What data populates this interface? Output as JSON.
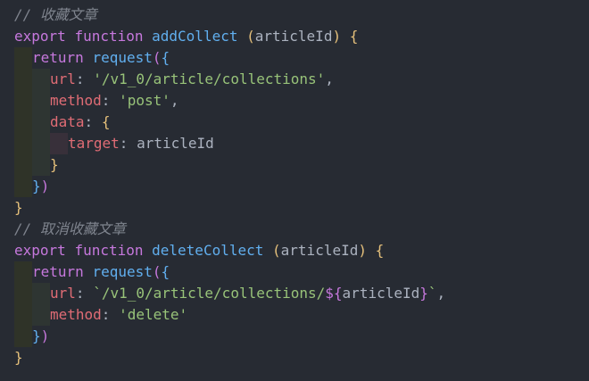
{
  "code": {
    "comment1": "// 收藏文章",
    "comment2": "// 取消收藏文章",
    "kw_export": "export",
    "kw_function": "function",
    "kw_return": "return",
    "fn_add": "addCollect",
    "fn_delete": "deleteCollect",
    "fn_request": "request",
    "param": "articleId",
    "prop_url": "url",
    "prop_method": "method",
    "prop_data": "data",
    "prop_target": "target",
    "colon": ":",
    "comma": ",",
    "open_paren": "(",
    "close_paren": ")",
    "open_brace": "{",
    "close_brace": "}",
    "str_add_url": "'/v1_0/article/collections'",
    "str_post": "'post'",
    "tmpl_delete_url_start": "`/v1_0/article/collections/",
    "tmpl_dollar": "${",
    "tmpl_close_brace": "}",
    "tmpl_backtick": "`",
    "str_delete": "'delete'",
    "target_value": "articleId"
  },
  "theme": {
    "background": "#272b33",
    "comment": "#7f848e",
    "keyword": "#c678dd",
    "function": "#61afef",
    "property": "#e06c75",
    "string": "#98c379",
    "plain": "#abb2bf",
    "bracket_level1": "#e5c07b",
    "bracket_level2": "#c678dd",
    "bracket_level3": "#61afef"
  }
}
